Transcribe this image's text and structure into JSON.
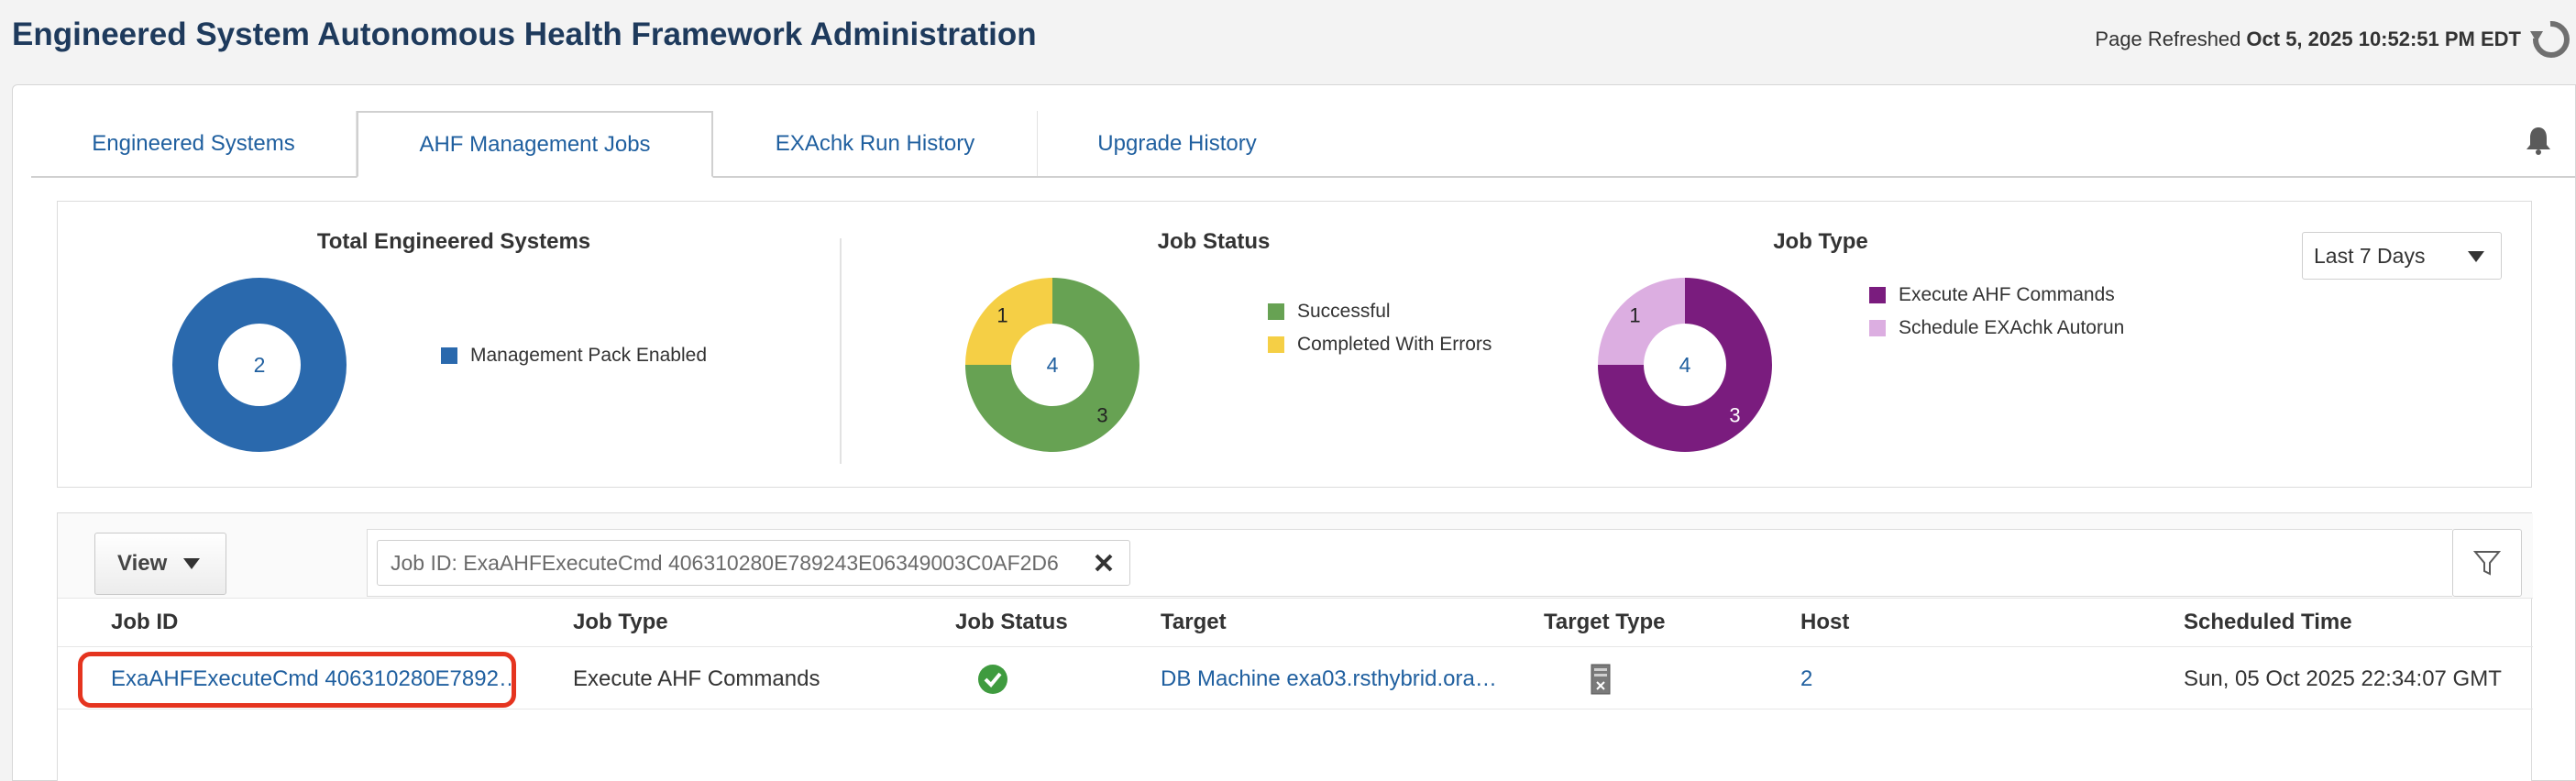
{
  "header": {
    "title": "Engineered System Autonomous Health Framework Administration",
    "refresh_label": "Page Refreshed",
    "refresh_time": "Oct 5, 2025 10:52:51 PM EDT"
  },
  "tabs": [
    {
      "label": "Engineered Systems",
      "active": false
    },
    {
      "label": "AHF Management Jobs",
      "active": true
    },
    {
      "label": "EXAchk Run History",
      "active": false
    },
    {
      "label": "Upgrade History",
      "active": false
    }
  ],
  "summary": {
    "range_select": "Last 7 Days",
    "total_systems": {
      "title": "Total Engineered Systems",
      "center": "2",
      "legend": [
        {
          "label": "Management Pack Enabled",
          "color": "#2a69ad"
        }
      ]
    },
    "job_status": {
      "title": "Job Status",
      "center": "4",
      "legend": [
        {
          "label": "Successful",
          "color": "#67a253"
        },
        {
          "label": "Completed With Errors",
          "color": "#f5cf45"
        }
      ]
    },
    "job_type": {
      "title": "Job Type",
      "center": "4",
      "legend": [
        {
          "label": "Execute AHF Commands",
          "color": "#7a1c7e"
        },
        {
          "label": "Schedule EXAchk Autorun",
          "color": "#dcaee1"
        }
      ]
    }
  },
  "chart_data": [
    {
      "type": "pie",
      "title": "Total Engineered Systems",
      "categories": [
        "Management Pack Enabled"
      ],
      "values": [
        2
      ],
      "colors": [
        "#2a69ad"
      ],
      "center_label": "2"
    },
    {
      "type": "pie",
      "title": "Job Status",
      "categories": [
        "Successful",
        "Completed With Errors"
      ],
      "values": [
        3,
        1
      ],
      "colors": [
        "#67a253",
        "#f5cf45"
      ],
      "center_label": "4"
    },
    {
      "type": "pie",
      "title": "Job Type",
      "categories": [
        "Execute AHF Commands",
        "Schedule EXAchk Autorun"
      ],
      "values": [
        3,
        1
      ],
      "colors": [
        "#7a1c7e",
        "#dcaee1"
      ],
      "center_label": "4"
    }
  ],
  "toolbar": {
    "view_label": "View",
    "filter_chip": "Job ID: ExaAHFExecuteCmd 406310280E789243E06349003C0AF2D6"
  },
  "table": {
    "columns": [
      "Job ID",
      "Job Type",
      "Job Status",
      "Target",
      "Target Type",
      "Host",
      "Scheduled Time"
    ],
    "rows": [
      {
        "job_id": "ExaAHFExecuteCmd 406310280E7892…",
        "job_type": "Execute AHF Commands",
        "job_status_icon": "success-check-icon",
        "target": "DB Machine exa03.rsthybrid.ora…",
        "target_type_icon": "server-icon",
        "host": "2",
        "scheduled_time": "Sun, 05 Oct 2025 22:34:07 GMT"
      }
    ]
  }
}
